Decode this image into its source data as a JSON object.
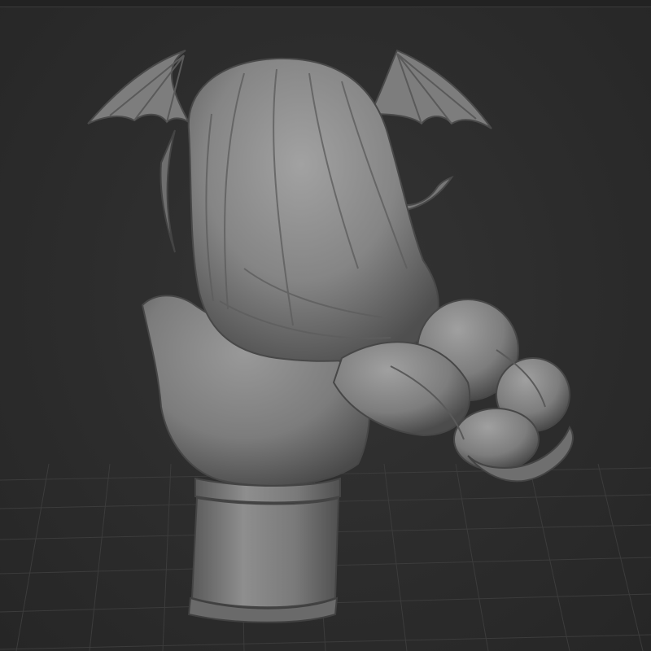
{
  "scene": {
    "background": "#2d2d2d",
    "grid_color": "#3b3b3b",
    "model_tone": "#8a8a8a",
    "model_highlight": "#a6a6a6",
    "model_shadow": "#4a4a4a"
  },
  "model": {
    "subject": "sculpted-bust",
    "parts": [
      "left-wing",
      "right-wing",
      "hair-back",
      "braid",
      "shoulders",
      "pedestal"
    ]
  }
}
